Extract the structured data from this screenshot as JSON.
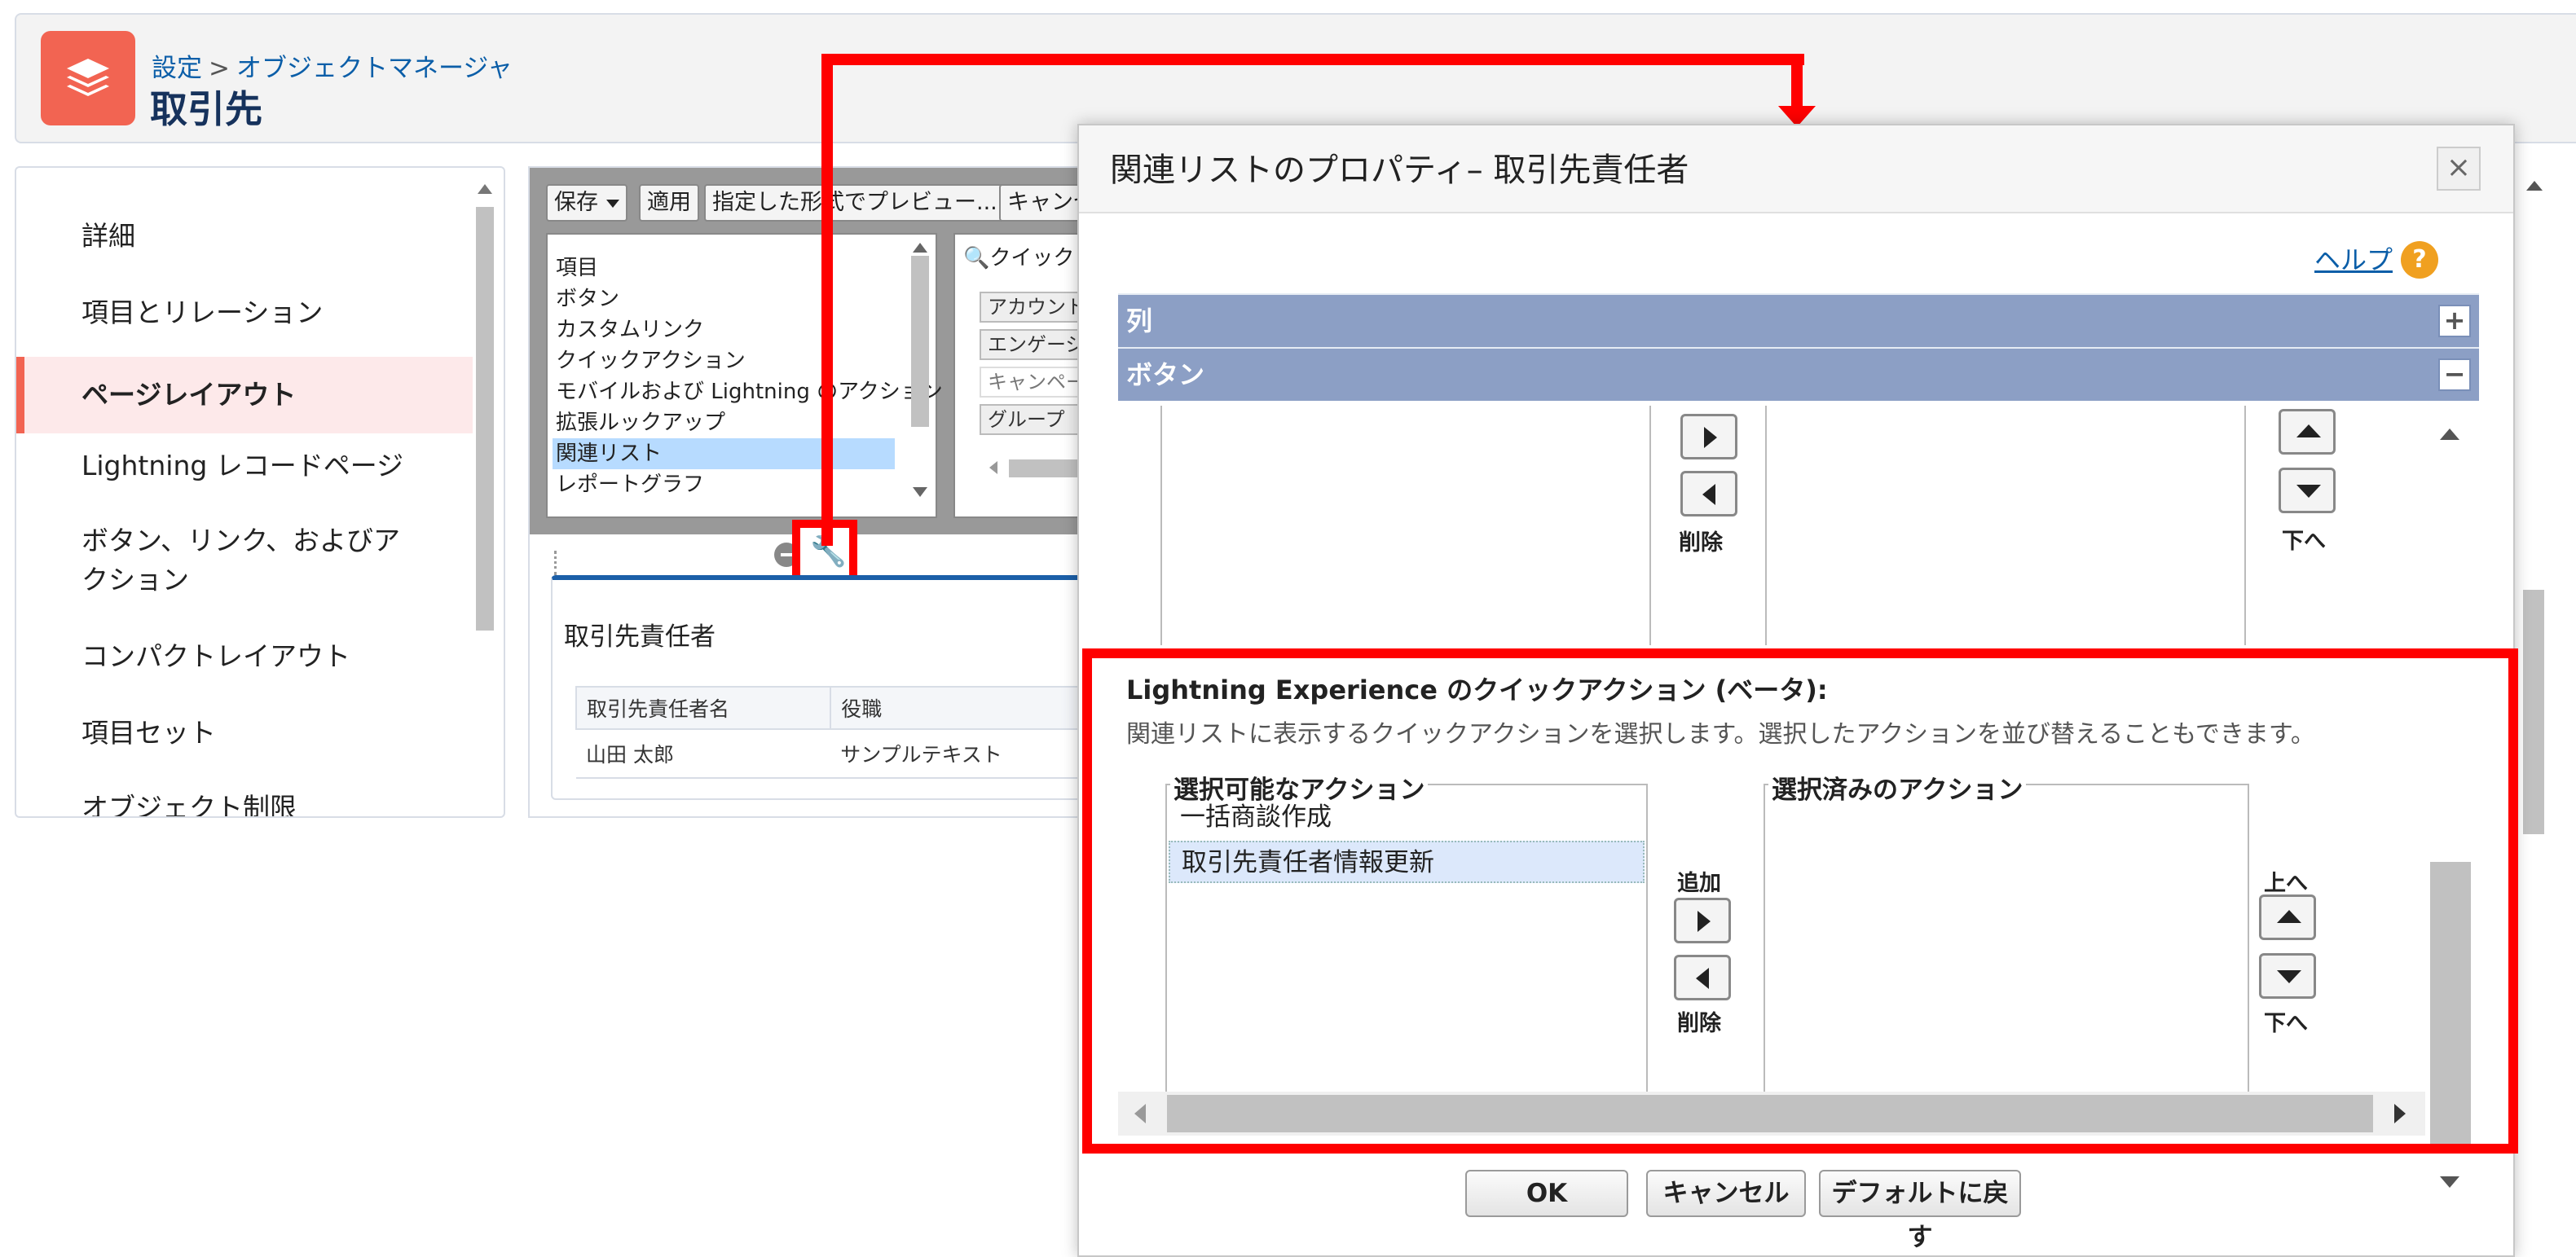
{
  "header": {
    "breadcrumb": [
      "設定",
      "オブジェクトマネージャ"
    ],
    "breadcrumb_sep": ">",
    "title": "取引先"
  },
  "sidebar": {
    "items": [
      {
        "label": "詳細"
      },
      {
        "label": "項目とリレーション"
      },
      {
        "label": "ページレイアウト",
        "active": true
      },
      {
        "label": "Lightning レコードページ"
      },
      {
        "label": "ボタン、リンク、およびア"
      },
      {
        "label": "クション"
      },
      {
        "label": "コンパクトレイアウト"
      },
      {
        "label": "項目セット"
      },
      {
        "label": "オブジェクト制限"
      }
    ]
  },
  "editor": {
    "toolbar": {
      "save": "保存",
      "apply": "適用",
      "preview": "指定した形式でプレビュー...",
      "cancel": "キャンセ"
    },
    "palette_items": [
      "項目",
      "ボタン",
      "カスタムリンク",
      "クイックアクション",
      "モバイルおよび Lightning のアクション",
      "拡張ルックアップ",
      "関連リスト",
      "レポートグラフ"
    ],
    "selected_palette_item": "関連リスト",
    "quick_find": "クイック",
    "quick_items": [
      "アカウント",
      "エンゲージ",
      "キャンペー",
      "グループ"
    ],
    "related_list": {
      "title": "取引先責任者",
      "columns": [
        "取引先責任者名",
        "役職"
      ],
      "rows": [
        [
          "山田 太郎",
          "サンプルテキスト"
        ]
      ]
    }
  },
  "dialog": {
    "title": "関連リストのプロパティ– 取引先責任者",
    "close": "×",
    "help_label": "ヘルプ",
    "help_icon": "?",
    "sections": {
      "columns": {
        "label": "列",
        "toggle": "+"
      },
      "buttons": {
        "label": "ボタン",
        "toggle": "−"
      }
    },
    "upper_controls": {
      "remove": "削除",
      "down": "下へ"
    },
    "quick_actions": {
      "title": "Lightning Experience のクイックアクション (ベータ):",
      "description": "関連リストに表示するクイックアクションを選択します。選択したアクションを並び替えることもできます。",
      "available_label": "選択可能なアクション",
      "selected_label": "選択済みのアクション",
      "available_items": [
        "一括商談作成",
        "取引先責任者情報更新"
      ],
      "selected_items": [],
      "add": "追加",
      "remove": "削除",
      "up": "上へ",
      "down": "下へ"
    },
    "footer": {
      "ok": "OK",
      "cancel": "キャンセル",
      "reset": "デフォルトに戻す"
    }
  },
  "colors": {
    "accent": "#f26452",
    "annotation": "#ff0000",
    "section_bar": "#8c9fc5",
    "link": "#0b5ea8"
  },
  "icons": {
    "logo": "layers-icon",
    "wrench": "wrench-icon",
    "help": "help-icon",
    "close": "close-icon"
  }
}
